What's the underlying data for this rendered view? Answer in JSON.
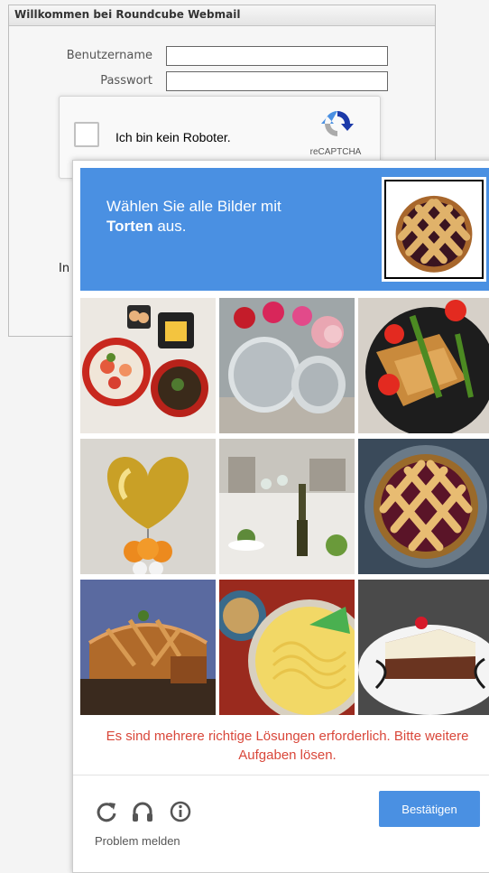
{
  "login": {
    "title": "Willkommen bei Roundcube Webmail",
    "username_label": "Benutzername",
    "password_label": "Passwort",
    "username_value": "",
    "password_value": "",
    "partial_text": "In"
  },
  "recaptcha_anchor": {
    "label": "Ich bin kein Roboter.",
    "brand": "reCAPTCHA",
    "checked": false
  },
  "challenge": {
    "instruction_prefix": "Wählen Sie alle Bilder mit",
    "instruction_keyword": "Torten",
    "instruction_suffix": " aus.",
    "tiles": [
      {
        "icon": "sushi-bowls-image"
      },
      {
        "icon": "flower-vase-image"
      },
      {
        "icon": "fried-toast-dish-image"
      },
      {
        "icon": "heart-balloon-image"
      },
      {
        "icon": "banquet-table-image"
      },
      {
        "icon": "lattice-pie-image"
      },
      {
        "icon": "meat-pie-image"
      },
      {
        "icon": "ramen-bowl-image"
      },
      {
        "icon": "cake-slice-image"
      }
    ],
    "error_line1": "Es sind mehrere richtige Lösungen erforderlich. Bitte weitere",
    "error_line2": "Aufgaben lösen.",
    "verify_label": "Bestätigen",
    "report_label": "Problem melden"
  },
  "colors": {
    "accent": "#4a90e2",
    "error": "#d9473a"
  }
}
